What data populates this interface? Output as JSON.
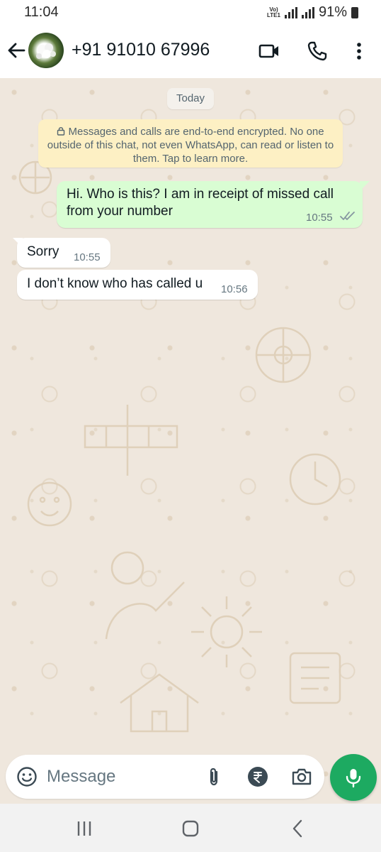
{
  "status_bar": {
    "time": "11:04",
    "network_label": "Vo)) LTE1",
    "battery": "91%"
  },
  "header": {
    "contact": "+91 91010 67996",
    "icons": [
      "back-arrow-icon",
      "video-call-icon",
      "phone-call-icon",
      "more-vert-icon"
    ]
  },
  "chat": {
    "date_chip": "Today",
    "encryption_notice": "Messages and calls are end-to-end encrypted. No one outside of this chat, not even WhatsApp, can read or listen to them. Tap to learn more.",
    "messages": [
      {
        "direction": "outgoing",
        "text": "Hi. Who is this? I am in receipt of missed call from your number",
        "time": "10:55",
        "status": "read"
      },
      {
        "direction": "incoming",
        "text": "Sorry",
        "time": "10:55"
      },
      {
        "direction": "incoming",
        "text": "I don’t know who has called u",
        "time": "10:56"
      }
    ]
  },
  "composer": {
    "placeholder": "Message",
    "icons": [
      "emoji-icon",
      "attach-icon",
      "rupee-payment-icon",
      "camera-icon",
      "mic-icon"
    ]
  },
  "colors": {
    "chat_background": "#efe7dd",
    "outgoing_bubble": "#d9fdd3",
    "incoming_bubble": "#ffffff",
    "notice_background": "#fdf0c4",
    "read_ticks": "#53bdeb",
    "accent_green": "#1daa61"
  }
}
